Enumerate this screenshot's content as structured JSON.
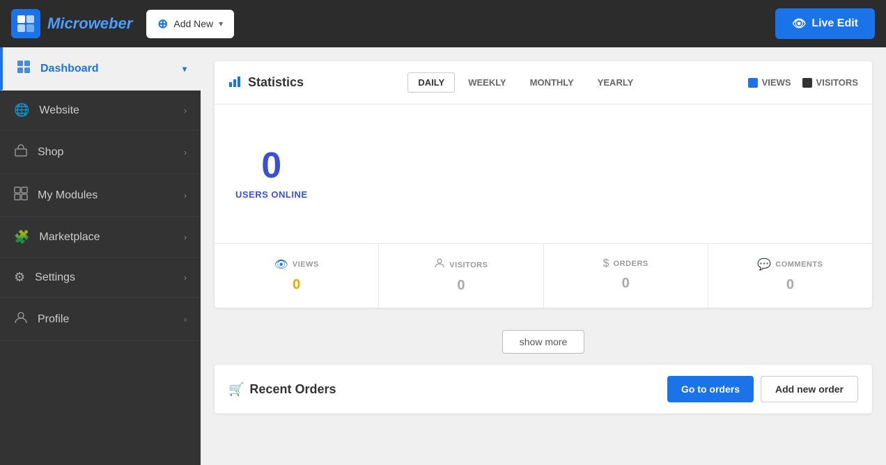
{
  "topbar": {
    "logo_text": "Microweber",
    "logo_letter": "M",
    "add_new_label": "Add New",
    "live_edit_label": "Live Edit"
  },
  "sidebar": {
    "items": [
      {
        "id": "dashboard",
        "label": "Dashboard",
        "icon": "⊞",
        "active": true
      },
      {
        "id": "website",
        "label": "Website",
        "icon": "🌐",
        "active": false
      },
      {
        "id": "shop",
        "label": "Shop",
        "icon": "🛍",
        "active": false
      },
      {
        "id": "my-modules",
        "label": "My Modules",
        "icon": "⊞",
        "active": false
      },
      {
        "id": "marketplace",
        "label": "Marketplace",
        "icon": "🧩",
        "active": false
      },
      {
        "id": "settings",
        "label": "Settings",
        "icon": "⚙",
        "active": false
      },
      {
        "id": "profile",
        "label": "Profile",
        "icon": "👤",
        "active": false
      }
    ]
  },
  "statistics": {
    "title": "Statistics",
    "tabs": [
      {
        "id": "daily",
        "label": "DAILY",
        "active": true
      },
      {
        "id": "weekly",
        "label": "WEEKLY",
        "active": false
      },
      {
        "id": "monthly",
        "label": "MONTHLY",
        "active": false
      },
      {
        "id": "yearly",
        "label": "YEARLY",
        "active": false
      }
    ],
    "legend": {
      "views_label": "VIEWS",
      "visitors_label": "VISITORS"
    },
    "users_online": "0",
    "users_online_label": "USERS ONLINE",
    "metrics": [
      {
        "id": "views",
        "label": "VIEWS",
        "value": "0",
        "active": true
      },
      {
        "id": "visitors",
        "label": "VISITORS",
        "value": "0",
        "active": false
      },
      {
        "id": "orders",
        "label": "ORDERS",
        "value": "0",
        "active": false
      },
      {
        "id": "comments",
        "label": "COMMENTS",
        "value": "0",
        "active": false
      }
    ],
    "show_more_label": "show more"
  },
  "recent_orders": {
    "title": "Recent Orders",
    "go_to_orders_label": "Go to orders",
    "add_new_order_label": "Add new order"
  }
}
